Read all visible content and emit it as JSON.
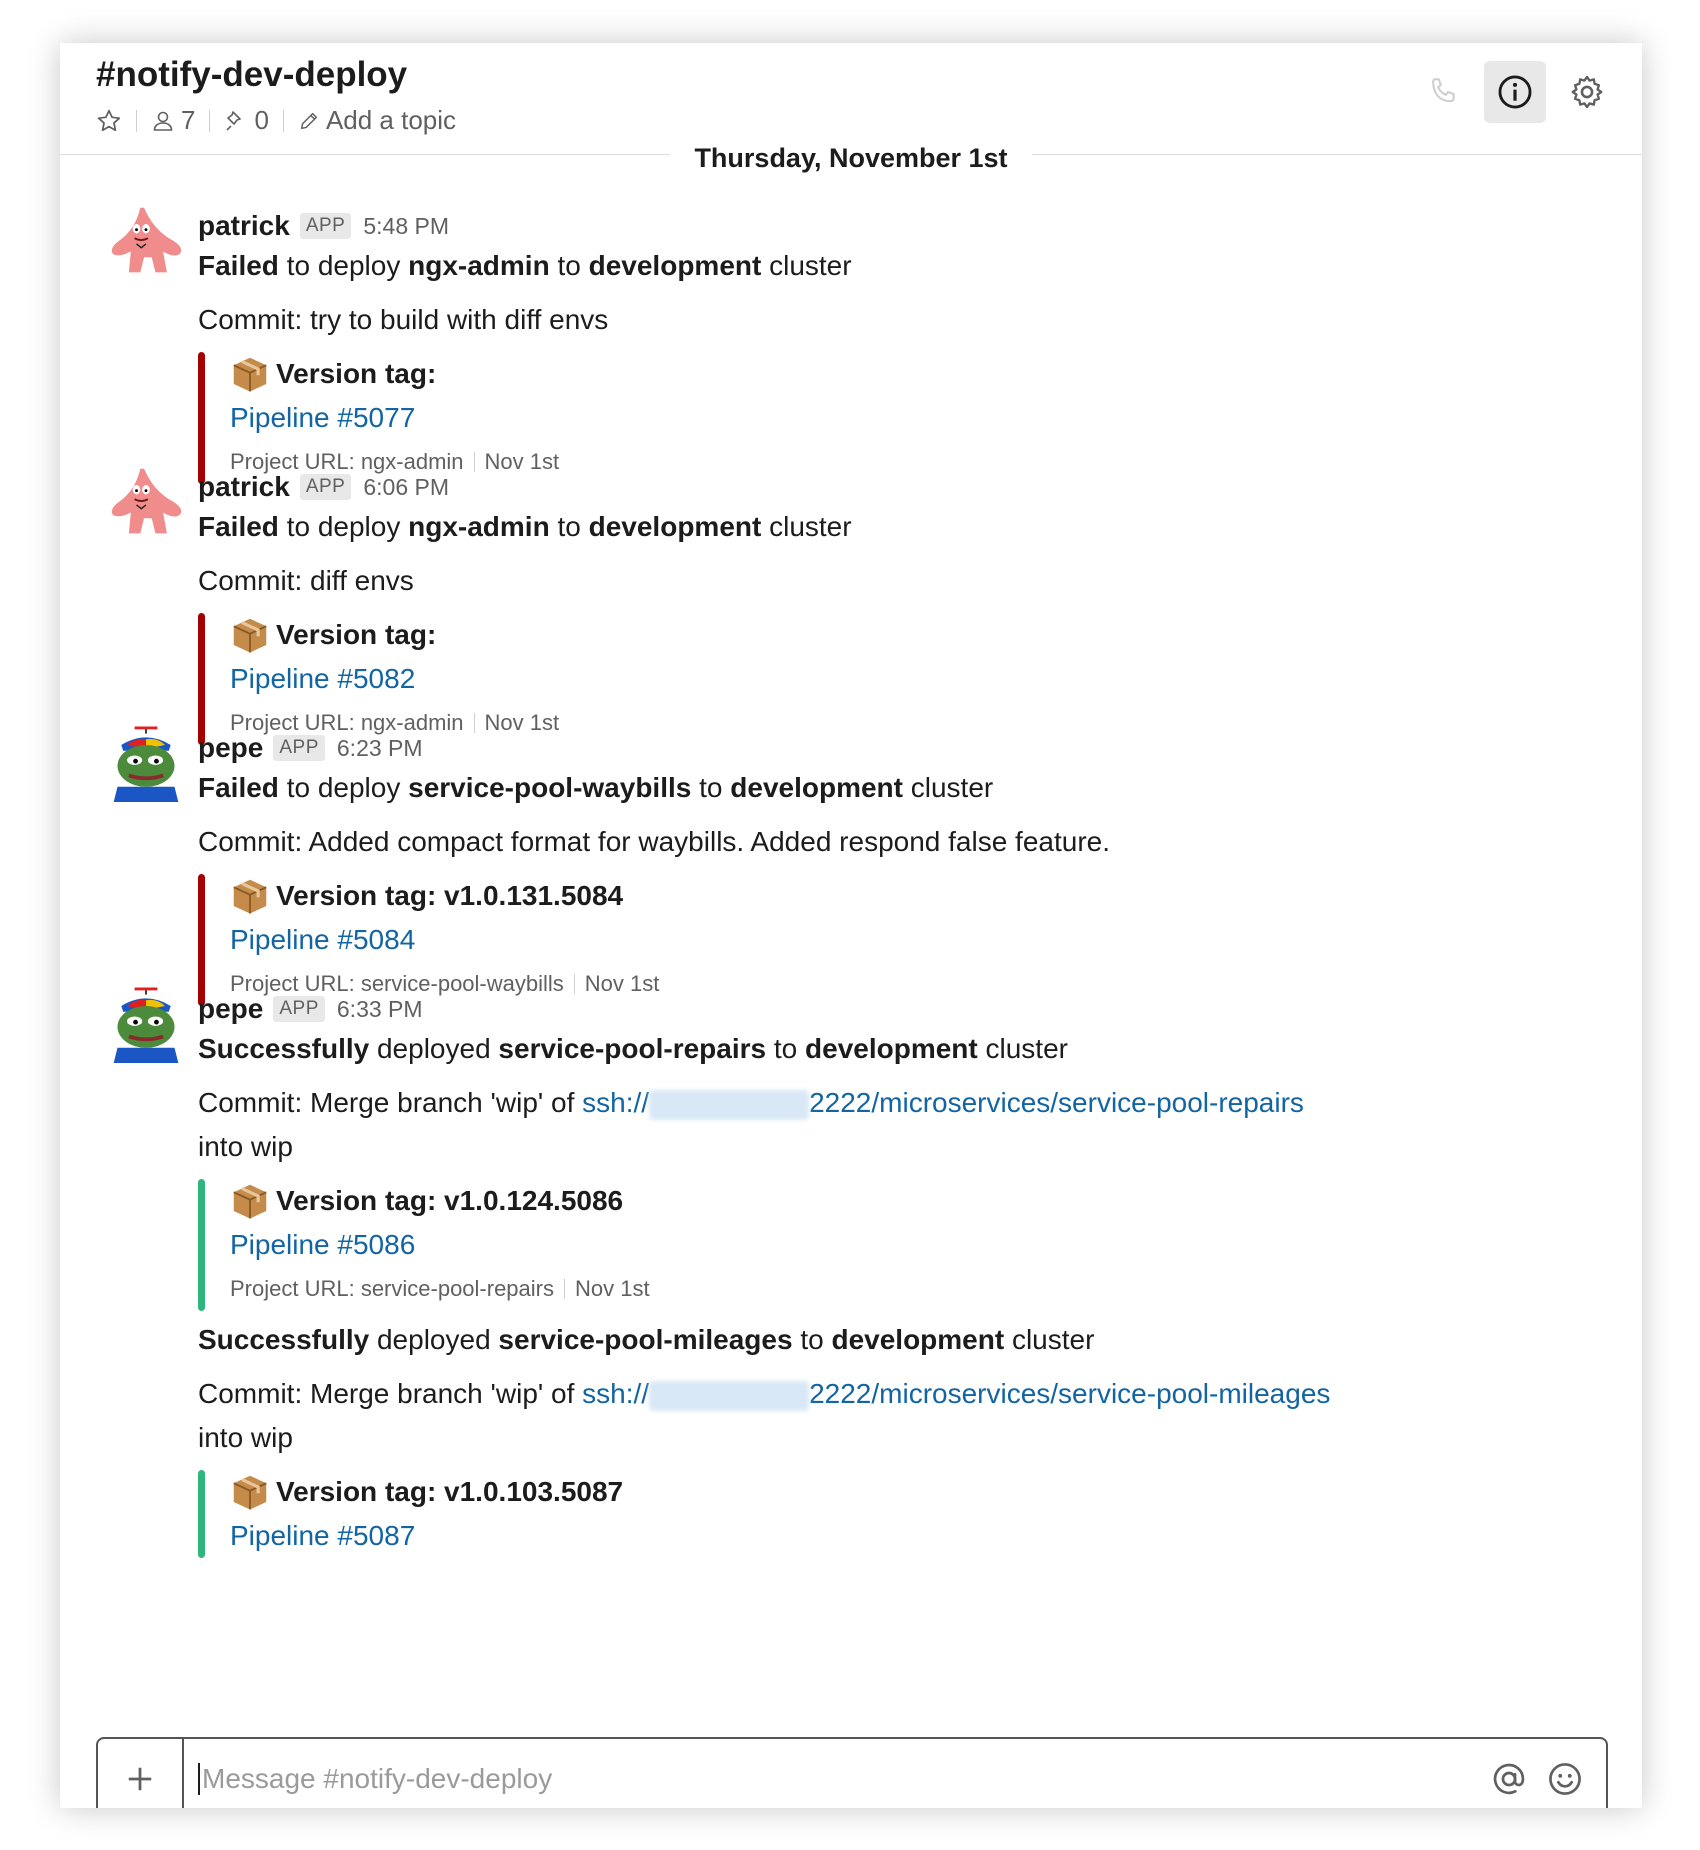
{
  "channel": {
    "name": "#notify-dev-deploy",
    "member_count": "7",
    "pinned_count": "0",
    "topic_placeholder": "Add a topic"
  },
  "date_divider": "Thursday, November 1st",
  "messages": [
    {
      "author": "patrick",
      "badge": "APP",
      "time": "5:48 PM",
      "status": "Failed",
      "verb": "to deploy",
      "service": "ngx-admin",
      "to": "to",
      "env": "development",
      "suffix": "cluster",
      "commit": "Commit: try to build with diff envs",
      "attachment": {
        "title": "Version tag:",
        "pipeline": "Pipeline #5077",
        "project": "Project URL: ngx-admin",
        "date": "Nov 1st",
        "color": "#a30200"
      }
    },
    {
      "author": "patrick",
      "badge": "APP",
      "time": "6:06 PM",
      "status": "Failed",
      "verb": "to deploy",
      "service": "ngx-admin",
      "to": "to",
      "env": "development",
      "suffix": "cluster",
      "commit": "Commit: diff envs",
      "attachment": {
        "title": "Version tag:",
        "pipeline": "Pipeline #5082",
        "project": "Project URL: ngx-admin",
        "date": "Nov 1st",
        "color": "#a30200"
      }
    },
    {
      "author": "pepe",
      "badge": "APP",
      "time": "6:23 PM",
      "status": "Failed",
      "verb": "to deploy",
      "service": "service-pool-waybills",
      "to": "to",
      "env": "development",
      "suffix": "cluster",
      "commit": "Commit: Added compact format for waybills. Added respond false feature.",
      "attachment": {
        "title": "Version tag: v1.0.131.5084",
        "pipeline": "Pipeline #5084",
        "project": "Project URL: service-pool-waybills",
        "date": "Nov 1st",
        "color": "#a30200"
      }
    },
    {
      "author": "pepe",
      "badge": "APP",
      "time": "6:33 PM",
      "status": "Successfully",
      "verb": "deployed",
      "service": "service-pool-repairs",
      "to": "to",
      "env": "development",
      "suffix": "cluster",
      "commit_prefix": "Commit: Merge branch 'wip' of",
      "commit_link_a": "ssh://",
      "commit_link_b": "2222/microservices/service-pool-repairs",
      "commit_suffix": "into wip",
      "attachment": {
        "title": "Version tag: v1.0.124.5086",
        "pipeline": "Pipeline #5086",
        "project": "Project URL: service-pool-repairs",
        "date": "Nov 1st",
        "color": "#2eb67d"
      }
    },
    {
      "status": "Successfully",
      "verb": "deployed",
      "service": "service-pool-mileages",
      "to": "to",
      "env": "development",
      "suffix": "cluster",
      "commit_prefix": "Commit: Merge branch 'wip' of",
      "commit_link_a": "ssh://",
      "commit_link_b": "2222/microservices/service-pool-mileages",
      "commit_suffix": "into wip",
      "attachment": {
        "title": "Version tag: v1.0.103.5087",
        "pipeline": "Pipeline #5087",
        "color": "#2eb67d"
      }
    }
  ],
  "composer": {
    "placeholder": "Message #notify-dev-deploy"
  },
  "icons": {
    "star": "star-icon",
    "members": "person-icon",
    "pins": "pin-icon",
    "topic": "pencil-icon",
    "call": "phone-icon",
    "info": "info-icon",
    "settings": "gear-icon",
    "attach": "plus-icon",
    "mention": "at-icon",
    "emoji": "smiley-icon",
    "package": "package-icon"
  },
  "colors": {
    "failed": "#a30200",
    "success": "#2eb67d",
    "link": "#1264a3"
  }
}
